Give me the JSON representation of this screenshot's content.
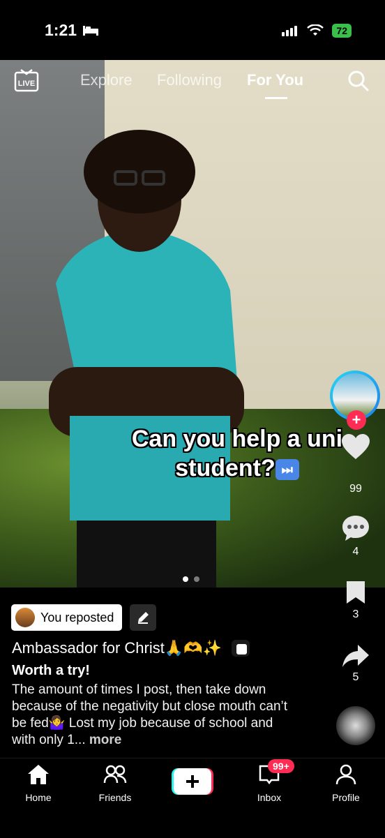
{
  "status_bar": {
    "time": "1:21",
    "battery": "72"
  },
  "top_nav": {
    "live_label": "LIVE",
    "tabs": [
      "Explore",
      "Following",
      "For You"
    ],
    "active_tab": "For You"
  },
  "video": {
    "caption_line1": "Can you help a uni",
    "caption_line2": "student?",
    "caption_emoji": "⏭"
  },
  "right_rail": {
    "likes": "99",
    "comments": "4",
    "saves": "3",
    "shares": "5"
  },
  "post": {
    "repost_label": "You reposted",
    "author": "Ambassador for Christ🙏🫶✨",
    "title": "Worth a try!",
    "description": "The amount of times I post, then take down because of the negativity but close mouth can’t be fed🤷‍♀️ Lost my job because of school and with only 1...",
    "more_label": "more"
  },
  "bottom_nav": {
    "home": "Home",
    "friends": "Friends",
    "inbox": "Inbox",
    "inbox_badge": "99+",
    "profile": "Profile"
  },
  "colors": {
    "accent": "#fe2c55",
    "battery": "#3ac04a",
    "tiktok_cyan": "#25f4ee"
  }
}
